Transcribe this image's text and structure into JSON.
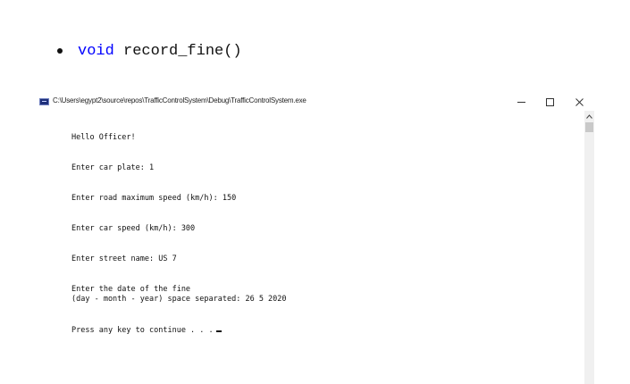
{
  "document": {
    "bullet_keyword": "void",
    "bullet_text": " record_fine()",
    "keyword_color": "#0000ff"
  },
  "console_window": {
    "title": "C:\\Users\\egypt2\\source\\repos\\TrafficControlSystem\\Debug\\TrafficControlSystem.exe",
    "controls": [
      "minimize",
      "maximize",
      "close"
    ],
    "lines": [
      "Hello Officer!",
      "Enter car plate: 1",
      "Enter road maximum speed (km/h): 150",
      "Enter car speed (km/h): 300",
      "Enter street name: US 7",
      "Enter the date of the fine",
      "(day - month - year) space separated: 26 5 2020",
      "Press any key to continue . . ."
    ]
  },
  "icons": {
    "app": "console-app-icon",
    "scroll_up": "chevron-up-icon"
  }
}
